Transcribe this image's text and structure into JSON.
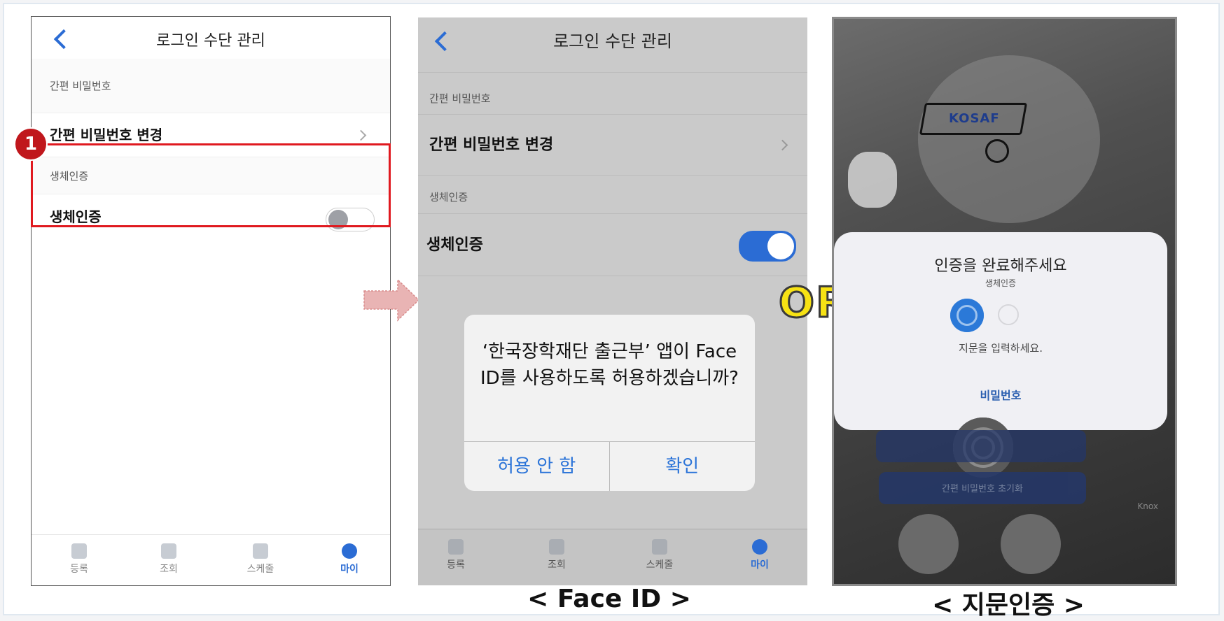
{
  "screens": {
    "first": {
      "header_title": "로그인 수단 관리",
      "section_password": "간편 비밀번호",
      "row_change_password": "간편 비밀번호 변경",
      "section_bio": "생체인증",
      "row_bio": "생체인증",
      "bio_toggle_on": false
    },
    "faceid": {
      "header_title": "로그인 수단 관리",
      "section_password": "간편 비밀번호",
      "row_change_password": "간편 비밀번호 변경",
      "section_bio": "생체인증",
      "row_bio": "생체인증",
      "bio_toggle_on": true,
      "alert": {
        "message": "‘한국장학재단 출근부’ 앱이 Face ID를 사용하도록 허용하겠습니까?",
        "deny_label": "허용 안 함",
        "confirm_label": "확인"
      }
    },
    "fingerprint": {
      "logo_text": "KOSAF",
      "dialog_title": "인증을 완료해주세요",
      "dialog_subtitle": "생체인증",
      "dialog_instruction": "지문을 입력하세요.",
      "password_link": "비밀번호",
      "reset_button": "간편 비밀번호 초기화",
      "knox_text": "Knox"
    }
  },
  "tabs": [
    {
      "label": "등록",
      "icon": "register-icon"
    },
    {
      "label": "조회",
      "icon": "search-icon"
    },
    {
      "label": "스케줄",
      "icon": "calendar-icon"
    },
    {
      "label": "마이",
      "icon": "profile-icon"
    }
  ],
  "annotations": {
    "step_number": "1",
    "or_label": "OR",
    "caption_faceid": "< Face ID >",
    "caption_fingerprint": "< 지문인증 >"
  },
  "colors": {
    "accent_blue": "#2b6cd4",
    "highlight_red": "#e0191f",
    "or_yellow": "#f7e214"
  }
}
